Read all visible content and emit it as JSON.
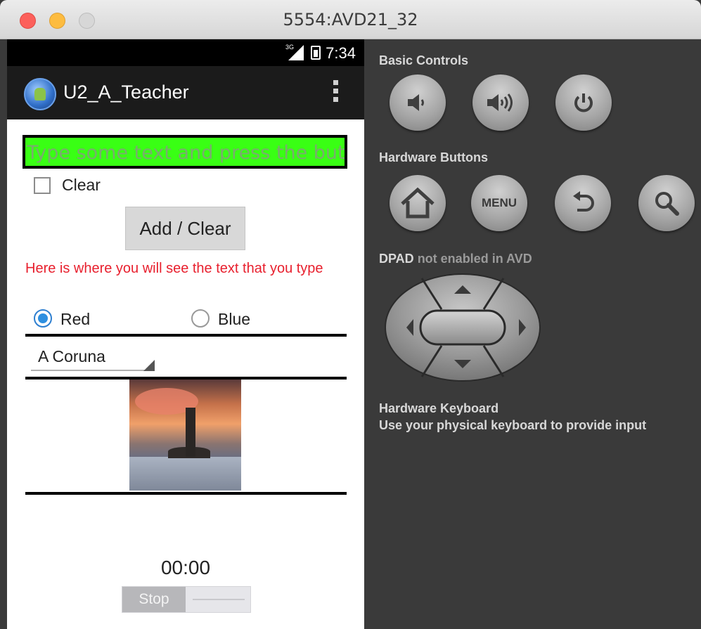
{
  "window": {
    "title": "5554:AVD21_32"
  },
  "status_bar": {
    "network": "3G",
    "time": "7:34"
  },
  "action_bar": {
    "app_title": "U2_A_Teacher"
  },
  "form": {
    "text_input_placeholder": "Type some text and press the button",
    "clear_checkbox_label": "Clear",
    "clear_checked": false,
    "add_button_label": "Add / Clear",
    "output_text": "Here is where you will see the text that you type",
    "radios": [
      {
        "label": "Red",
        "selected": true
      },
      {
        "label": "Blue",
        "selected": false
      }
    ],
    "spinner_value": "A Coruna",
    "timer": "00:00",
    "toggle_label": "Stop"
  },
  "colors": {
    "input_background": "#39ff14",
    "output_text": "#e8202e",
    "radio_selected": "#2e8fe0"
  },
  "panel": {
    "basic_controls_title": "Basic Controls",
    "hardware_buttons_title": "Hardware Buttons",
    "dpad_title_prefix": "DPAD",
    "dpad_title_suffix": "not enabled in AVD",
    "keyboard_title": "Hardware Keyboard",
    "keyboard_subtitle": "Use your physical keyboard to provide input",
    "menu_button_label": "MENU",
    "icons": [
      "volume-down-icon",
      "volume-up-icon",
      "power-icon",
      "home-icon",
      "back-icon",
      "search-icon",
      "dpad-up-icon",
      "dpad-down-icon",
      "dpad-left-icon",
      "dpad-right-icon"
    ]
  }
}
